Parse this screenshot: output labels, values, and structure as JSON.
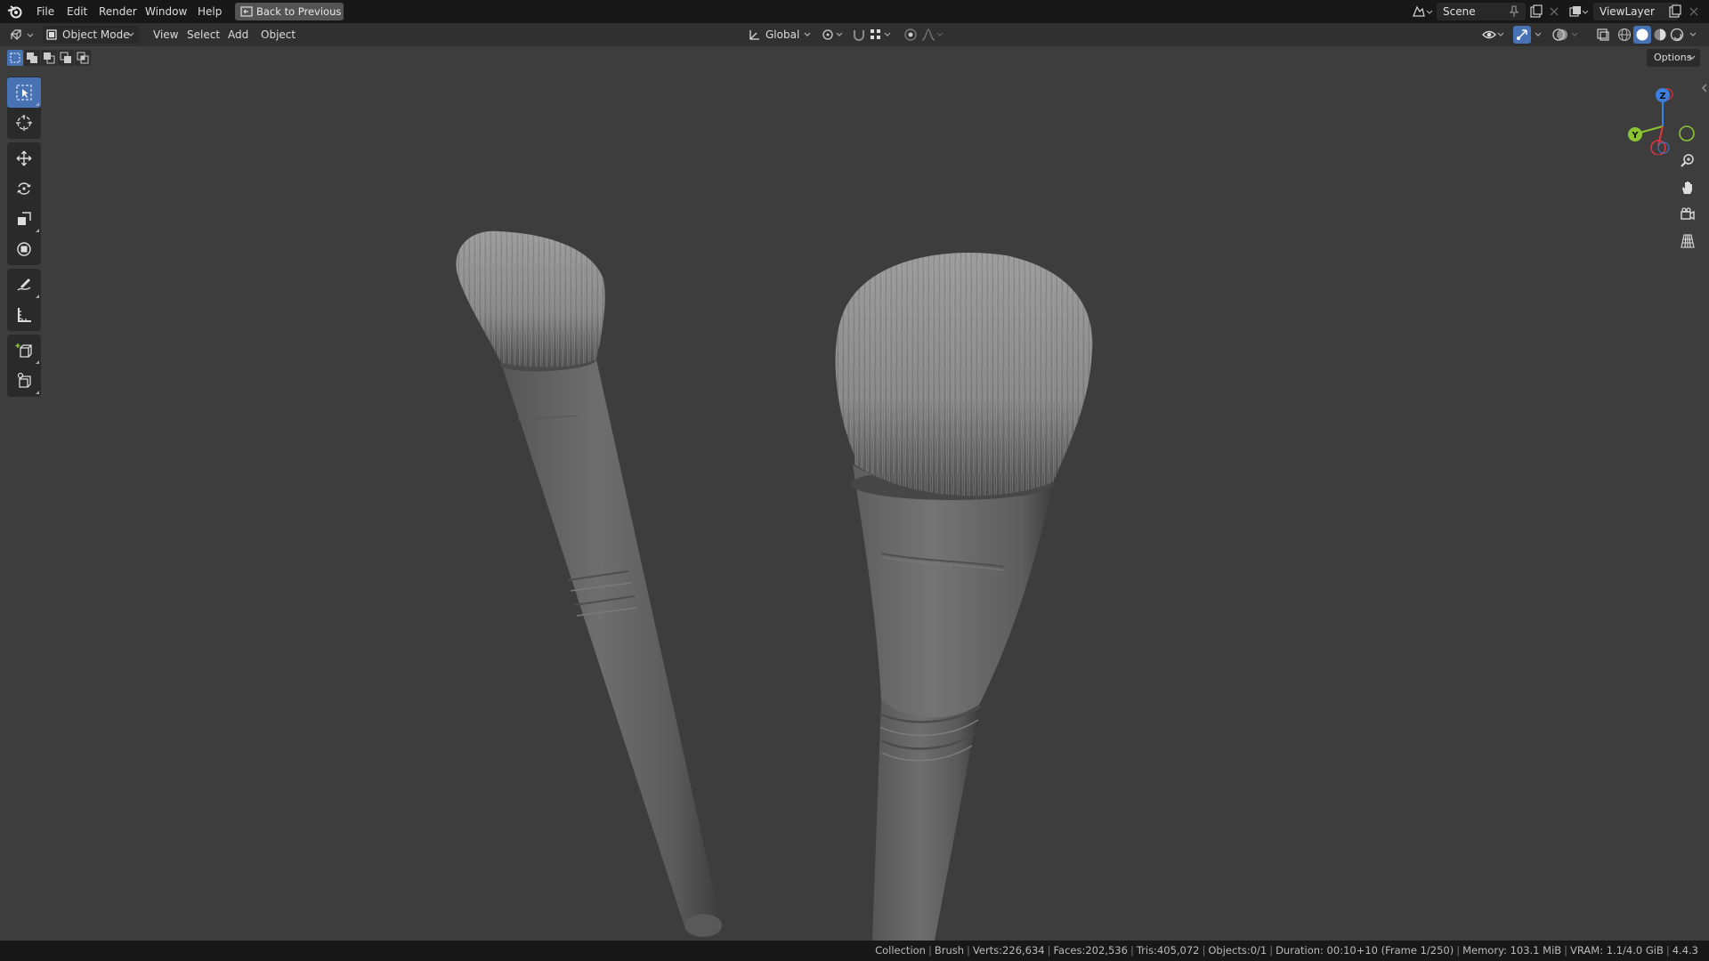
{
  "topbar": {
    "menus": [
      "File",
      "Edit",
      "Render",
      "Window",
      "Help"
    ],
    "back_label": "Back to Previous",
    "scene_label": "Scene",
    "viewlayer_label": "ViewLayer"
  },
  "header": {
    "mode_label": "Object Mode",
    "menus": [
      "View",
      "Select",
      "Add",
      "Object"
    ],
    "orientation_label": "Global"
  },
  "viewport": {
    "options_label": "Options",
    "gizmo": {
      "z": "Z",
      "y": "Y"
    }
  },
  "statusbar": {
    "collection": "Collection",
    "object": "Brush",
    "verts": "Verts:226,634",
    "faces": "Faces:202,536",
    "tris": "Tris:405,072",
    "objects": "Objects:0/1",
    "duration": "Duration: 00:10+10 (Frame 1/250)",
    "memory": "Memory: 103.1 MiB",
    "vram": "VRAM: 1.1/4.0 GiB",
    "version": "4.4.3"
  },
  "colors": {
    "accent": "#4772b3",
    "viewport_bg": "#3d3d3d",
    "axis_x": "#e0343f",
    "axis_y": "#8bc534",
    "axis_z": "#3b7fe0"
  }
}
